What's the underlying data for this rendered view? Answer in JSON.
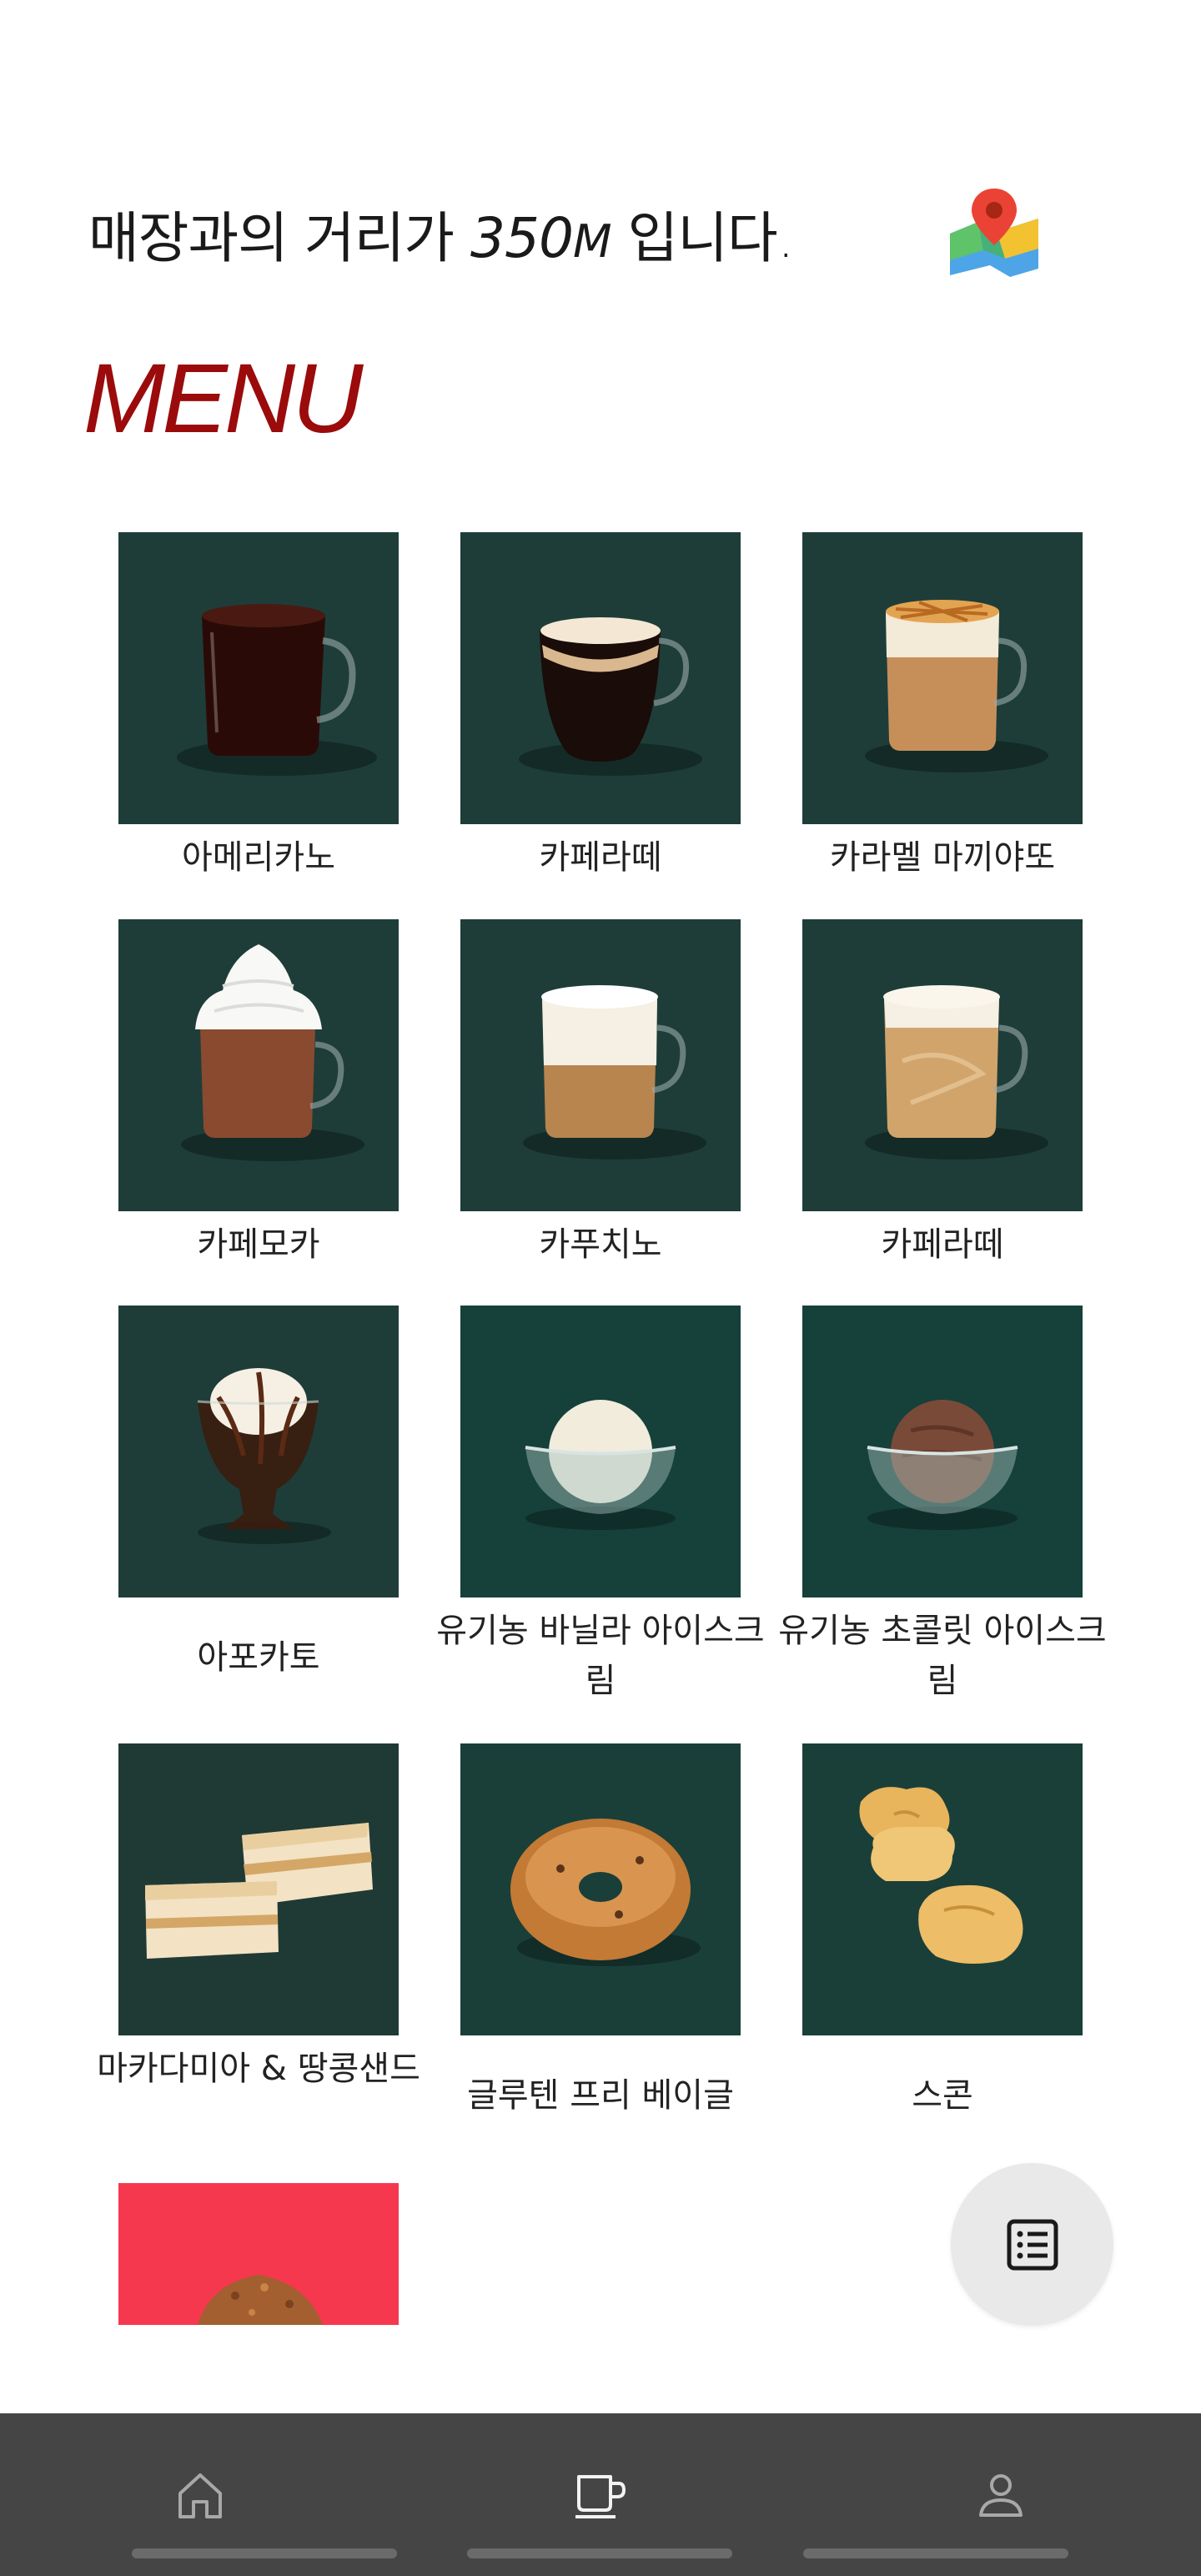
{
  "header": {
    "distance_prefix": "매장과의 거리가 ",
    "distance_value": "350",
    "distance_unit": "M",
    "distance_suffix": " 입니다.",
    "map_icon": "map-pin-icon"
  },
  "menu_title": "MENU",
  "menu_items": [
    {
      "name": "아메리카노",
      "icon": "americano-image"
    },
    {
      "name": "카페라떼",
      "icon": "latte-image"
    },
    {
      "name": "카라멜 마끼야또",
      "icon": "caramel-macchiato-image"
    },
    {
      "name": "카페모카",
      "icon": "mocha-image"
    },
    {
      "name": "카푸치노",
      "icon": "cappuccino-image"
    },
    {
      "name": "카페라떼",
      "icon": "latte-image"
    },
    {
      "name": "아포카토",
      "icon": "affogato-image"
    },
    {
      "name": "유기농 바닐라 아이스크림",
      "icon": "vanilla-icecream-image"
    },
    {
      "name": "유기농 초콜릿 아이스크림",
      "icon": "chocolate-icecream-image"
    },
    {
      "name": "마카다미아 & 땅콩샌드",
      "icon": "sandwich-image"
    },
    {
      "name": "글루텐 프리 베이글",
      "icon": "bagel-image"
    },
    {
      "name": "스콘",
      "icon": "scone-image"
    },
    {
      "name": "",
      "icon": "dessert-image"
    }
  ],
  "fab": {
    "icon": "list-icon"
  },
  "bottom_nav": [
    {
      "icon": "home-icon",
      "selected": false
    },
    {
      "icon": "coffee-cup-icon",
      "selected": true
    },
    {
      "icon": "person-icon",
      "selected": false
    }
  ],
  "colors": {
    "tile_bg": "#1e3d38",
    "menu_title": "#9b0b0b",
    "nav_bg": "#454545",
    "last_tile_bg": "#f5384e"
  }
}
